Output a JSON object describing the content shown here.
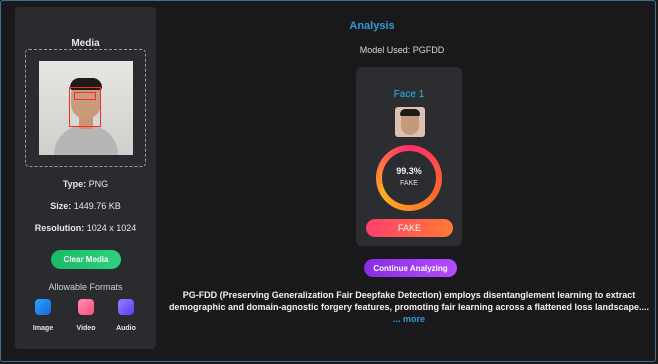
{
  "media": {
    "title": "Media",
    "type_label": "Type:",
    "type_value": "PNG",
    "size_label": "Size:",
    "size_value": "1449.76 KB",
    "resolution_label": "Resolution:",
    "resolution_value": "1024 x 1024",
    "clear_button": "Clear Media",
    "formats_title": "Allowable Formats",
    "formats": [
      {
        "label": "Image",
        "icon": "image-icon",
        "color": "#1e90ff"
      },
      {
        "label": "Video",
        "icon": "video-icon",
        "color": "#ff6fa1"
      },
      {
        "label": "Audio",
        "icon": "audio-icon",
        "color": "#7b5cff"
      }
    ]
  },
  "analysis": {
    "title": "Analysis",
    "model_used": "Model Used: PGFDD",
    "face_title": "Face 1",
    "score": "99.3%",
    "score_fraction": 0.993,
    "verdict_small": "FAKE",
    "verdict": "FAKE",
    "continue_button": "Continue Analyzing",
    "description": "PG-FDD (Preserving Generalization Fair Deepfake Detection) employs disentanglement learning to extract demographic and domain-agnostic forgery features, promoting fair learning across a flattened loss landscape....",
    "more_link": "... more"
  },
  "colors": {
    "accent": "#2f9ad8",
    "fake_gradient_start": "#ff3f6c",
    "fake_gradient_end": "#ff7a35",
    "clear_button": "#18b968",
    "continue_button": "#8a2be2"
  }
}
